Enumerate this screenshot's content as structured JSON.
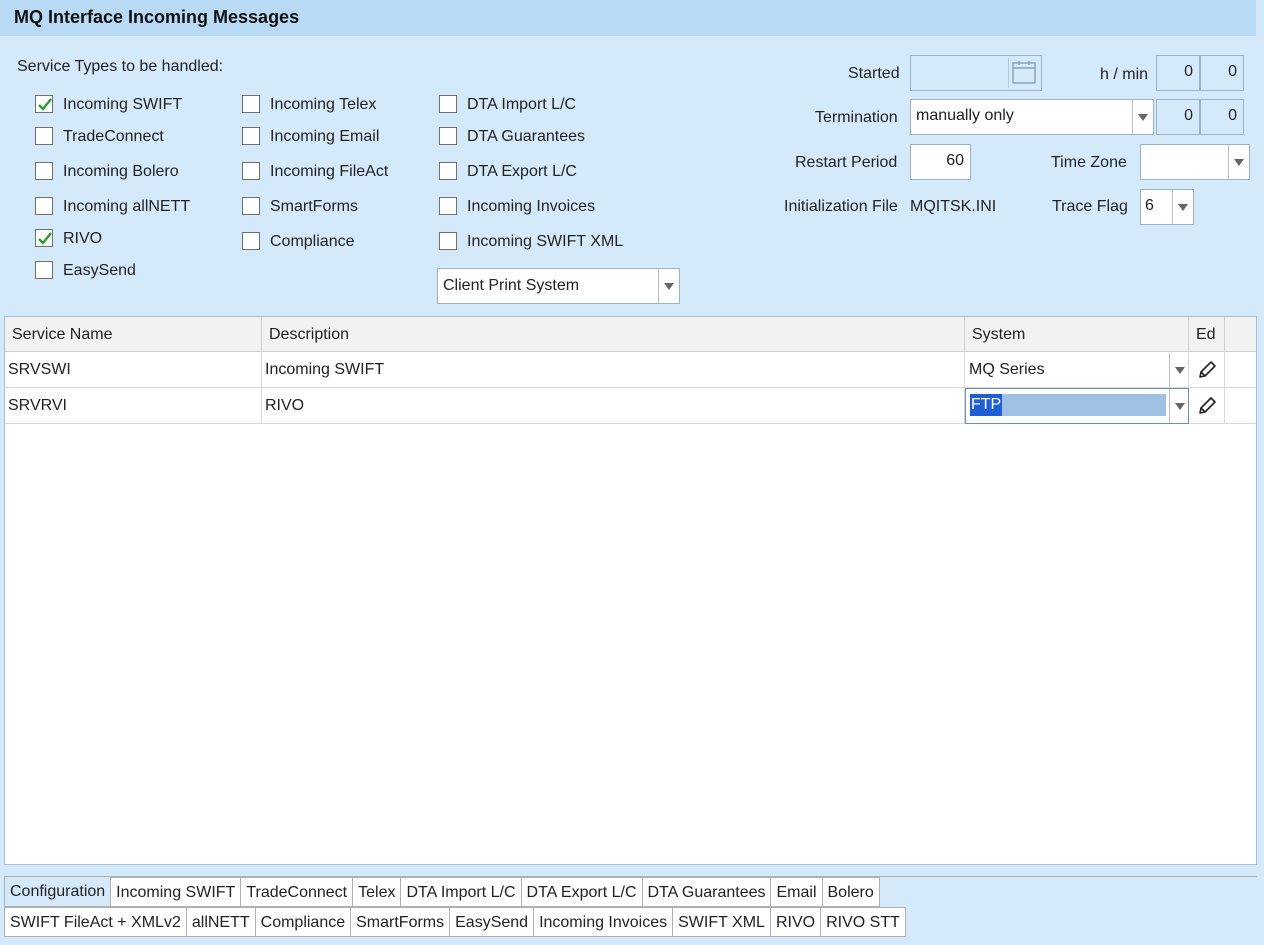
{
  "window": {
    "title": "MQ Interface Incoming Messages"
  },
  "service_types": {
    "label": "Service Types to be handled:",
    "items": [
      {
        "label": "Incoming SWIFT",
        "checked": true
      },
      {
        "label": "TradeConnect",
        "checked": false
      },
      {
        "label": "Incoming Bolero",
        "checked": false
      },
      {
        "label": "Incoming allNETT",
        "checked": false
      },
      {
        "label": "RIVO",
        "checked": true
      },
      {
        "label": "EasySend",
        "checked": false
      },
      {
        "label": "Incoming Telex",
        "checked": false
      },
      {
        "label": "Incoming Email",
        "checked": false
      },
      {
        "label": "Incoming FileAct",
        "checked": false
      },
      {
        "label": "SmartForms",
        "checked": false
      },
      {
        "label": "Compliance",
        "checked": false
      },
      {
        "label": "DTA Import L/C",
        "checked": false
      },
      {
        "label": "DTA Guarantees",
        "checked": false
      },
      {
        "label": "DTA Export L/C",
        "checked": false
      },
      {
        "label": "Incoming Invoices",
        "checked": false
      },
      {
        "label": "Incoming SWIFT XML",
        "checked": false
      }
    ],
    "client_print_value": "Client Print System"
  },
  "settings": {
    "started_label": "Started",
    "started_value": "",
    "hmin_label": "h / min",
    "started_h": "0",
    "started_min": "0",
    "termination_label": "Termination",
    "termination_value": "manually only",
    "termination_h": "0",
    "termination_min": "0",
    "restart_label": "Restart Period",
    "restart_value": "60",
    "timezone_label": "Time Zone",
    "timezone_value": "",
    "initfile_label": "Initialization File",
    "initfile_value": "MQITSK.INI",
    "traceflag_label": "Trace Flag",
    "traceflag_value": "6"
  },
  "grid": {
    "columns": [
      "Service Name",
      "Description",
      "System",
      "Ed"
    ],
    "rows": [
      {
        "name": "SRVSWI",
        "description": "Incoming SWIFT",
        "system": "MQ Series"
      },
      {
        "name": "SRVRVI",
        "description": "RIVO",
        "system": "FTP"
      }
    ]
  },
  "tabs_row1": [
    "Configuration",
    "Incoming SWIFT",
    "TradeConnect",
    "Telex",
    "DTA Import L/C",
    "DTA Export L/C",
    "DTA Guarantees",
    "Email",
    "Bolero"
  ],
  "tabs_row2": [
    "SWIFT FileAct + XMLv2",
    "allNETT",
    "Compliance",
    "SmartForms",
    "EasySend",
    "Incoming Invoices",
    "SWIFT XML",
    "RIVO",
    "RIVO STT"
  ],
  "colors": {
    "background": "#d4eafb",
    "titlebar": "#b9daf5",
    "selection": "#1f5fd6",
    "check": "#2e9e2e"
  }
}
